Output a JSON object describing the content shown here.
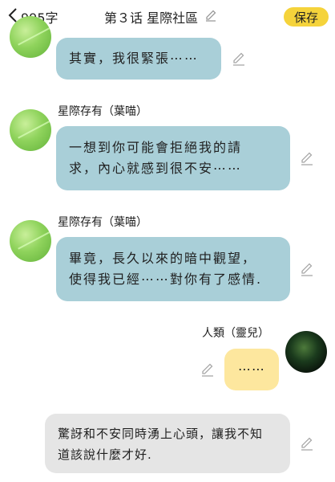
{
  "header": {
    "word_count": "995字",
    "title": "第３话 星際社區",
    "save_label": "保存"
  },
  "messages": [
    {
      "text": "其實，我很緊張⋯⋯"
    },
    {
      "sender": "星際存有（葉喵）",
      "lines": [
        "一想到你可能會拒絕我的請",
        "求，內心就感到很不安⋯⋯"
      ]
    },
    {
      "sender": "星際存有（葉喵）",
      "lines": [
        "畢竟，長久以來的暗中觀望，",
        "使得我已經⋯⋯對你有了感情."
      ]
    },
    {
      "sender": "人類（靈兒）",
      "text": "⋯⋯"
    },
    {
      "lines": [
        "驚訝和不安同時湧上心頭，讓我不知",
        "道該說什麼才好."
      ]
    }
  ],
  "colors": {
    "accent": "#f5d33b",
    "alien_bubble": "#a9cfd8",
    "human_bubble": "#fde79e",
    "narration_bubble": "#e5e5e5"
  }
}
